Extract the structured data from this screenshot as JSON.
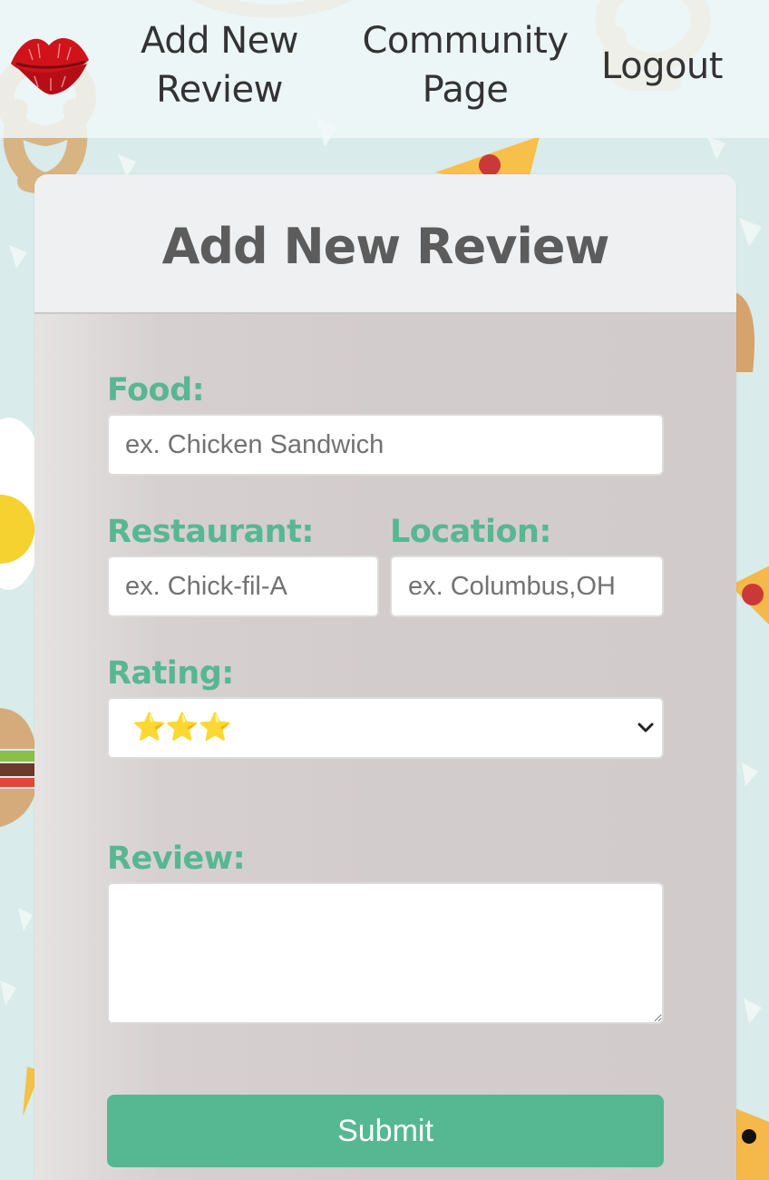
{
  "navbar": {
    "logo_icon": "lips-kiss-icon",
    "links": {
      "add_review_line1": "Add New",
      "add_review_line2": "Review",
      "community_line1": "Community",
      "community_line2": "Page",
      "logout": "Logout"
    }
  },
  "form": {
    "title": "Add New Review",
    "food": {
      "label": "Food:",
      "placeholder": "ex. Chicken Sandwich",
      "value": ""
    },
    "restaurant": {
      "label": "Restaurant:",
      "placeholder": "ex. Chick-fil-A",
      "value": ""
    },
    "location": {
      "label": "Location:",
      "placeholder": "ex. Columbus,OH",
      "value": ""
    },
    "rating": {
      "label": "Rating:",
      "selected": "⭐⭐⭐",
      "stars": 3
    },
    "review": {
      "label": "Review:",
      "value": ""
    },
    "submit_label": "Submit"
  },
  "colors": {
    "accent": "#56b793",
    "label": "#57b793",
    "title": "#5c5c5c",
    "page_background": "#d9ebea",
    "lips": "#d0121b"
  }
}
